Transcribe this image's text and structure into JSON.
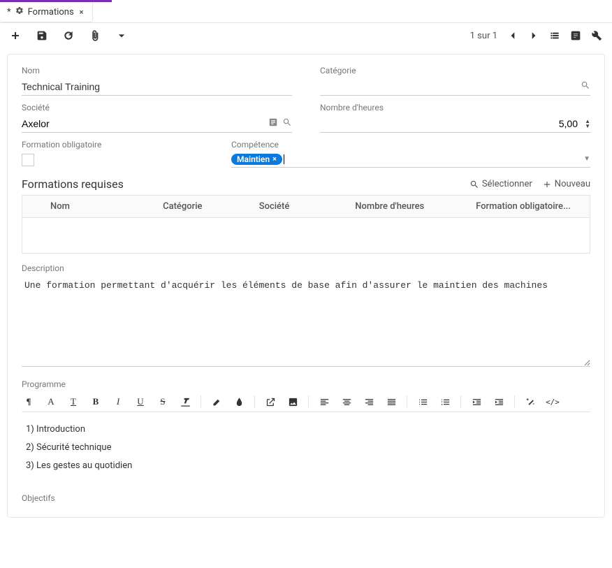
{
  "tab": {
    "dirty_marker": "*",
    "title": "Formations"
  },
  "paging": {
    "text": "1 sur 1"
  },
  "fields": {
    "nom": {
      "label": "Nom",
      "value": "Technical Training"
    },
    "categorie": {
      "label": "Catégorie",
      "value": ""
    },
    "societe": {
      "label": "Société",
      "value": "Axelor"
    },
    "nb_heures": {
      "label": "Nombre d'heures",
      "value": "5,00"
    },
    "obligatoire": {
      "label": "Formation obligatoire"
    },
    "competence": {
      "label": "Compétence",
      "chip": "Maintien"
    }
  },
  "subgrid": {
    "title": "Formations requises",
    "select_label": "Sélectionner",
    "new_label": "Nouveau",
    "cols": {
      "nom": "Nom",
      "categorie": "Catégorie",
      "societe": "Société",
      "nb_heures": "Nombre d'heures",
      "obligatoire": "Formation obligatoire..."
    }
  },
  "description": {
    "label": "Description",
    "value": "Une formation permettant d'acquérir les éléments de base afin d'assurer le maintien des machines"
  },
  "programme": {
    "label": "Programme",
    "lines": [
      "1) Introduction",
      "2) Sécurité technique",
      "3) Les gestes au quotidien"
    ]
  },
  "objectifs": {
    "label": "Objectifs"
  }
}
